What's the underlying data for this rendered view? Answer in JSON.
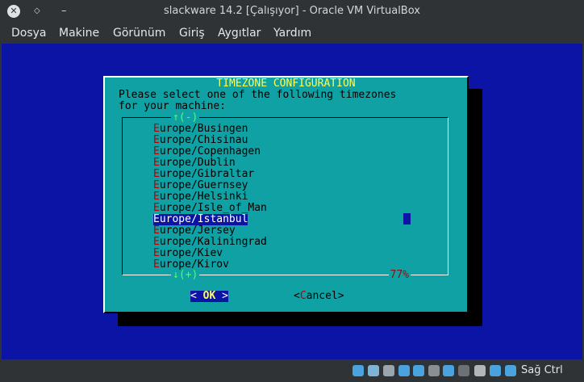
{
  "window": {
    "title": "slackware 14.2 [Çalışıyor] - Oracle VM VirtualBox",
    "close_glyph": "✕",
    "maximize_glyph": "◇",
    "minimize_glyph": "–"
  },
  "menubar": [
    "Dosya",
    "Makine",
    "Görünüm",
    "Giriş",
    "Aygıtlar",
    "Yardım"
  ],
  "dialog": {
    "title": "TIMEZONE CONFIGURATION",
    "prompt": "Please select one of the following timezones\nfor your machine:",
    "scroll_up": "↑(-)",
    "scroll_down": "↓(+)",
    "scroll_percent": "77%",
    "scroll_position": 0.77,
    "items": [
      {
        "first": "E",
        "rest": "urope/Busingen"
      },
      {
        "first": "E",
        "rest": "urope/Chisinau"
      },
      {
        "first": "E",
        "rest": "urope/Copenhagen"
      },
      {
        "first": "E",
        "rest": "urope/Dublin"
      },
      {
        "first": "E",
        "rest": "urope/Gibraltar"
      },
      {
        "first": "E",
        "rest": "urope/Guernsey"
      },
      {
        "first": "E",
        "rest": "urope/Helsinki"
      },
      {
        "first": "E",
        "rest": "urope/Isle_of_Man"
      },
      {
        "first": "E",
        "rest": "urope/Istanbul",
        "selected": true
      },
      {
        "first": "E",
        "rest": "urope/Jersey"
      },
      {
        "first": "E",
        "rest": "urope/Kaliningrad"
      },
      {
        "first": "E",
        "rest": "urope/Kiev"
      },
      {
        "first": "E",
        "rest": "urope/Kirov"
      }
    ],
    "ok": {
      "left": "<",
      "pad": " ",
      "label": "OK",
      "right": ">"
    },
    "cancel": {
      "left": "<",
      "hot": "C",
      "rest": "ancel",
      "right": ">"
    }
  },
  "statusbar": {
    "icons": [
      "hard-disk-icon",
      "optical-drive-icon",
      "audio-icon",
      "network-icon",
      "usb-icon",
      "shared-folders-icon",
      "display-icon",
      "recording-icon",
      "cpu-icon",
      "mouse-integration-icon",
      "keyboard-icon"
    ],
    "host_key": "Sağ Ctrl"
  },
  "colors": {
    "guest_background": "#0c14a6",
    "dialog": "#0fa1a3",
    "title_text": "#ffff55",
    "hotkey": "#b00000",
    "arrows": "#55ff55"
  }
}
